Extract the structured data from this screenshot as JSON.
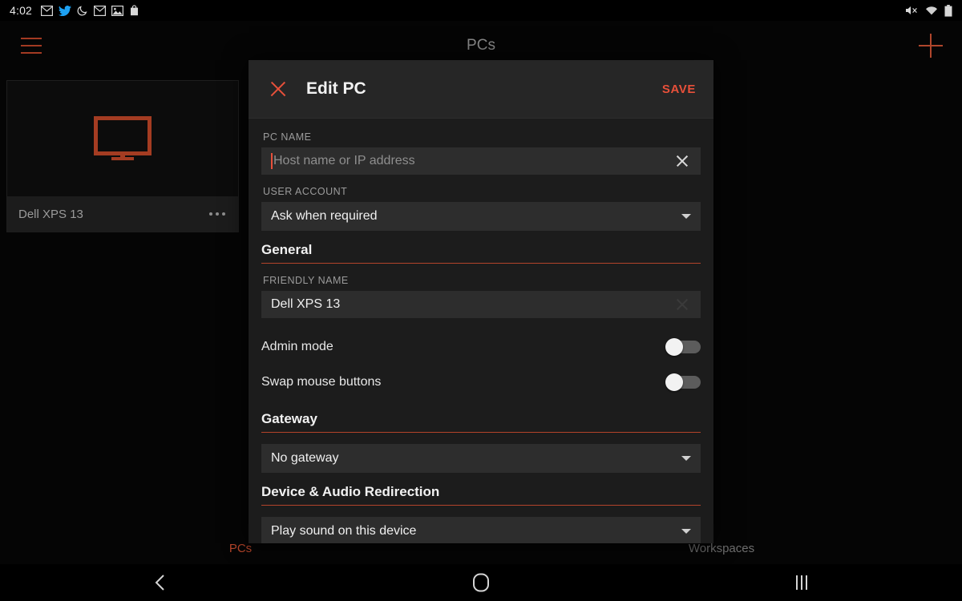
{
  "status_bar": {
    "clock": "4:02",
    "left_icons": [
      "gmail-icon",
      "twitter-icon",
      "moon-icon",
      "gmail-icon",
      "photo-icon",
      "shopping-bag-icon"
    ],
    "right_icons": [
      "volume-mute-icon",
      "wifi-icon",
      "battery-icon"
    ]
  },
  "app_bar": {
    "menu_icon": "hamburger-icon",
    "title": "PCs",
    "add_icon": "plus-icon",
    "accent_color": "#b0462c"
  },
  "pc_list": [
    {
      "name": "Dell XPS 13",
      "thumb_icon": "monitor-icon",
      "overflow_icon": "more-horizontal-icon"
    }
  ],
  "bottom_tabs": [
    {
      "label": "PCs",
      "active": true
    },
    {
      "label": "Workspaces",
      "active": false
    }
  ],
  "nav_bar": {
    "back_icon": "chevron-left-icon",
    "home_icon": "home-circle-icon",
    "recents_icon": "recents-bars-icon"
  },
  "dialog": {
    "close_icon": "close-x-icon",
    "title": "Edit PC",
    "save_label": "SAVE",
    "accent_color": "#e8503a",
    "pc_name": {
      "label": "PC NAME",
      "placeholder": "Host name or IP address",
      "value": "",
      "clear_icon": "clear-x-icon",
      "focused": true
    },
    "user_account": {
      "label": "USER ACCOUNT",
      "value": "Ask when required",
      "caret_icon": "chevron-down-icon"
    },
    "general_section": {
      "title": "General",
      "friendly_name": {
        "label": "FRIENDLY NAME",
        "value": "Dell XPS 13",
        "clear_icon": "clear-x-icon"
      },
      "toggles": [
        {
          "label": "Admin mode",
          "on": false
        },
        {
          "label": "Swap mouse buttons",
          "on": false
        }
      ]
    },
    "gateway_section": {
      "title": "Gateway",
      "value": "No gateway",
      "caret_icon": "chevron-down-icon"
    },
    "redirection_section": {
      "title": "Device & Audio Redirection",
      "value": "Play sound on this device",
      "caret_icon": "chevron-down-icon"
    }
  }
}
